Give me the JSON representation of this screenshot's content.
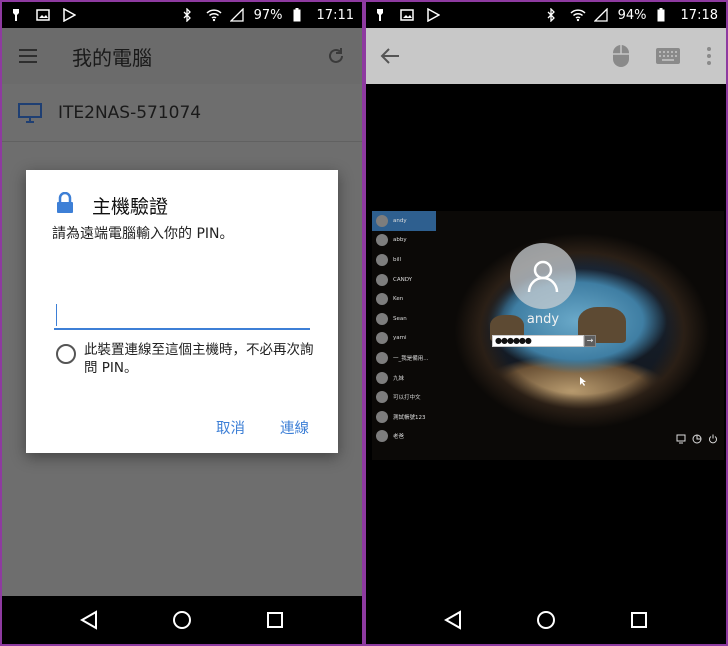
{
  "left": {
    "status": {
      "battery": "97%",
      "time": "17:11"
    },
    "appbar": {
      "title": "我的電腦"
    },
    "computer": {
      "name": "ITE2NAS-571074"
    },
    "dialog": {
      "title": "主機驗證",
      "message": "請為遠端電腦輸入你的 PIN。",
      "pin_value": "",
      "checkbox_label": "此裝置連線至這個主機時，不必再次詢問 PIN。",
      "cancel_label": "取消",
      "connect_label": "連線"
    }
  },
  "right": {
    "status": {
      "battery": "94%",
      "time": "17:18"
    },
    "login": {
      "users": [
        "andy",
        "abby",
        "bill",
        "CANDY",
        "Ken",
        "Sean",
        "yami",
        "一_我是備用...",
        "九妹",
        "可以打中文",
        "測試帳號123",
        "老爸"
      ],
      "selected_user": "andy",
      "big_username": "andy",
      "password_mask": "●●●●●●"
    }
  },
  "colors": {
    "accent": "#3d7fd6",
    "frame": "#8e3aa0"
  }
}
